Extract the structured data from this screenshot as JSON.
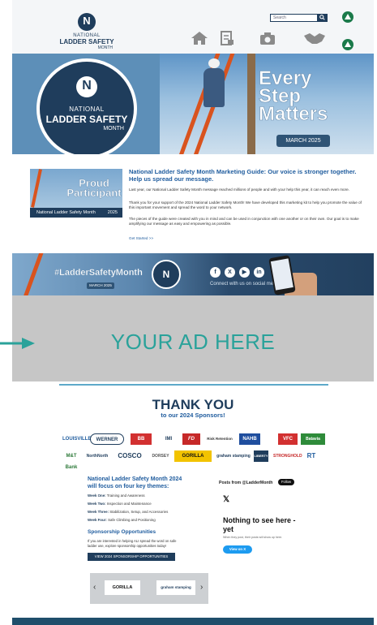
{
  "header": {
    "logo": {
      "line1": "NATIONAL",
      "line2": "LADDER SAFETY",
      "line3": "MONTH"
    },
    "search_placeholder": "Search",
    "nav": [
      "home-icon",
      "document-icon",
      "camera-icon",
      "handshake-icon"
    ]
  },
  "hero": {
    "badge": {
      "line1": "NATIONAL",
      "line2": "LADDER SAFETY",
      "line3": "MONTH"
    },
    "headline": [
      "Every",
      "Step",
      "Matters"
    ],
    "date_pill": "MARCH 2025"
  },
  "guide": {
    "proud_line1": "Proud",
    "proud_line2": "Participant",
    "proud_bar": "National Ladder Safety Month",
    "proud_year": "2025",
    "heading": "National Ladder Safety Month Marketing Guide: Our voice is stronger together. Help us spread our message.",
    "p1": "Last year, our National Ladder Safety Month message reached millions of people and with your help this year, it can reach even more.",
    "p2": "Thank you for your support of the 2024 National Ladder Safety Month! We have developed this marketing kit to help you promote the value of this important movement and spread the word to your network.",
    "p3": "The pieces of the guide were created with you in mind and can be used in conjunction with one another or on their own. Our goal is to make amplifying our message as easy and empowering as possible.",
    "link": "Get Started >>"
  },
  "social": {
    "hashtag": "#LadderSafetyMonth",
    "pill": "MARCH 2025",
    "icons": [
      "f",
      "X",
      "▶",
      "in"
    ],
    "cta": "Connect with us on social media."
  },
  "ad": {
    "text": "YOUR AD HERE"
  },
  "sponsors": {
    "title": "THANK YOU",
    "subtitle": "to our 2024 Sponsors!",
    "row1": [
      "LOUISVILLE",
      "WERNER",
      "BB",
      "IMI",
      "FD",
      "Risk Retention",
      "NAHB",
      "VFC",
      "Batavia"
    ],
    "row2": [
      "M&T Bank",
      "NorthNorth",
      "COSCO",
      "DORSEY",
      "GORILLA",
      "graham stamping",
      "LIBERTY",
      "STRONGHOLD",
      "RT"
    ]
  },
  "focus": {
    "heading": "National Ladder Safety Month 2024 will focus on four key themes:",
    "weeks": [
      {
        "label": "Week One:",
        "text": "Training and Awareness"
      },
      {
        "label": "Week Two:",
        "text": "Inspection and Maintenance"
      },
      {
        "label": "Week Three:",
        "text": "Stabilization, Setup, and Accessories"
      },
      {
        "label": "Week Four:",
        "text": "Safe Climbing and Positioning"
      }
    ],
    "opp_heading": "Sponsorship Opportunities",
    "opp_text": "If you are interested in helping ALI spread the word on safe ladder use, explore sponsorship opportunities today!",
    "opp_button": "VIEW 2024 SPONSORSHIP OPPORTUNITIES"
  },
  "carousel": {
    "left": "‹",
    "right": "›",
    "logos": [
      "GORILLA",
      "graham stamping"
    ]
  },
  "twitter": {
    "heading": "Posts from @LadderMonth",
    "follow": "Follow",
    "x": "𝕏",
    "title": "Nothing to see here - yet",
    "sub": "When they post, their posts will show up here.",
    "button": "View on X"
  },
  "colors": {
    "navy": "#1f3d5c",
    "teal": "#2aa29a",
    "accent_blue": "#1f5c9e"
  }
}
